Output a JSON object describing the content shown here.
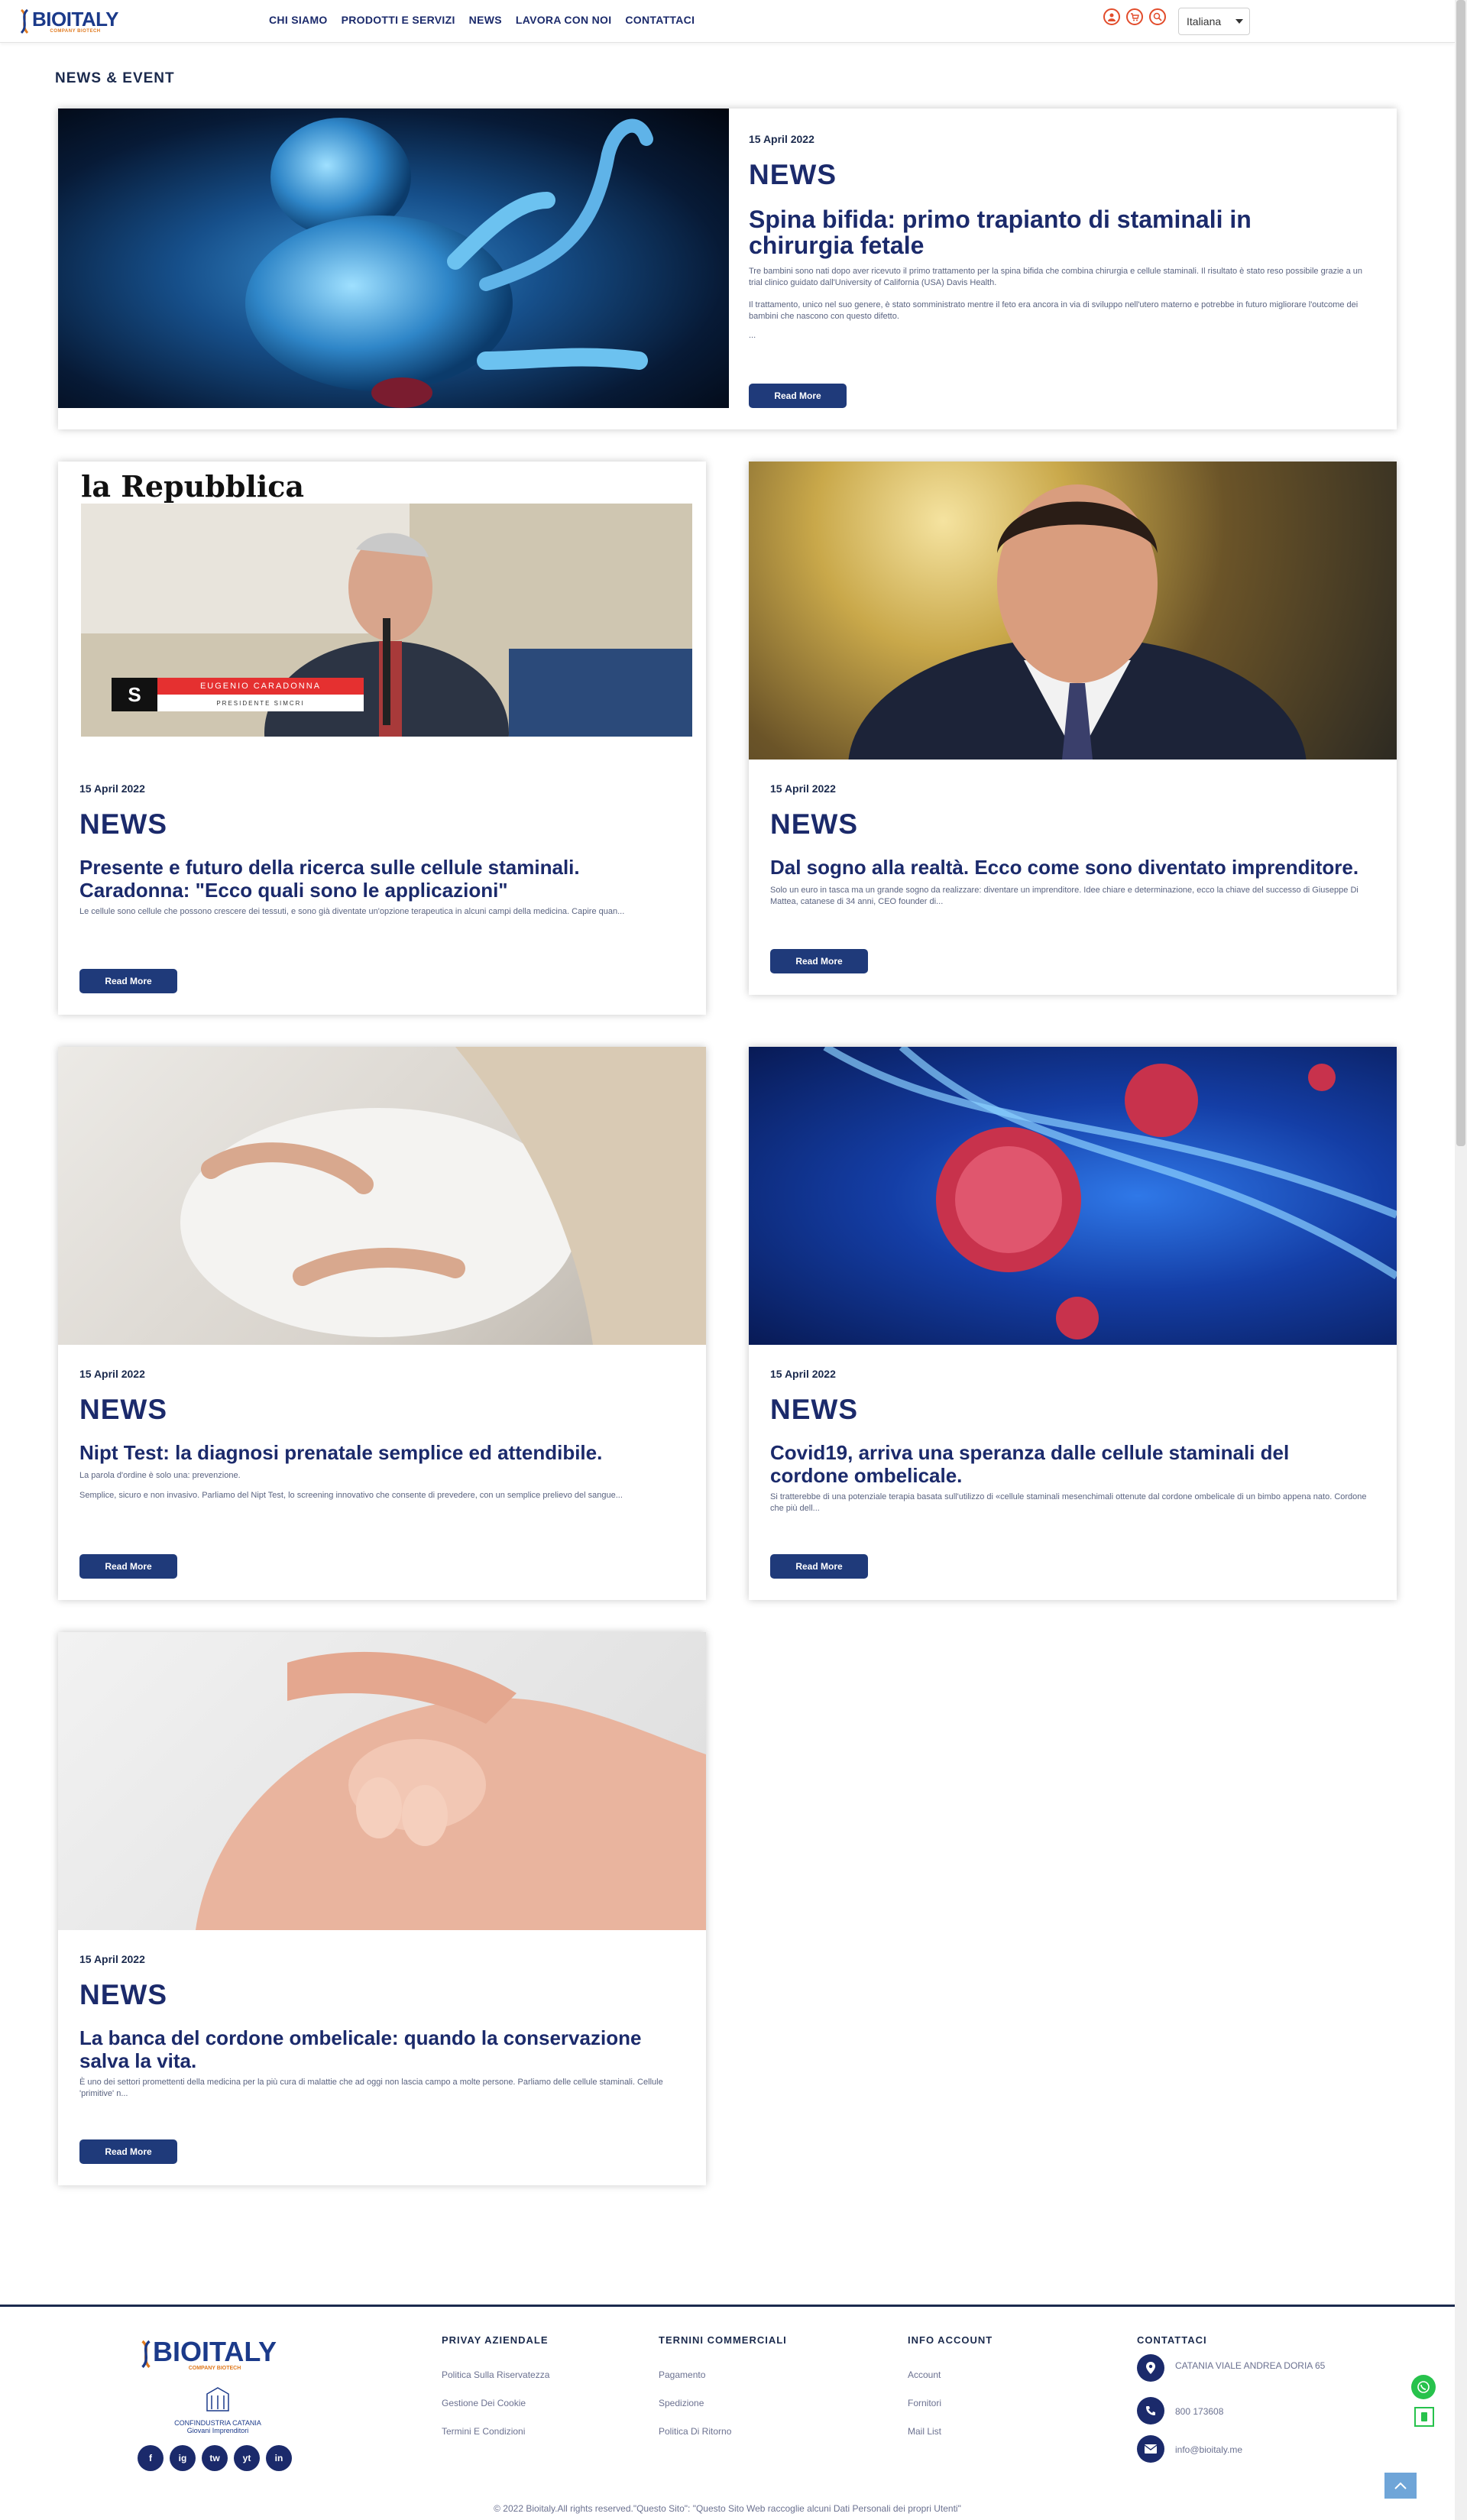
{
  "header": {
    "brand": "BIOITALY",
    "brand_sub": "COMPANY BIOTECH",
    "nav": [
      "CHI SIAMO",
      "PRODOTTI E SERVIZI",
      "NEWS",
      "LAVORA CON NOI",
      "CONTATTACI"
    ],
    "language": "Italiana",
    "icons": [
      "user-icon",
      "cart-icon",
      "search-icon"
    ]
  },
  "section_title": "NEWS & EVENT",
  "read_more": "Read More",
  "articles": [
    {
      "date": "15 April 2022",
      "label": "NEWS",
      "title": "Spina bifida: primo trapianto di staminali in chirurgia fetale",
      "excerpt": "Tre bambini sono nati dopo aver ricevuto il primo trattamento per la spina bifida che combina chirurgia e cellule staminali. Il risultato è stato reso possibile grazie a un trial clinico guidato dall'University of California (USA) Davis Health.",
      "excerpt2": "Il trattamento, unico nel suo genere, è stato somministrato mentre il feto era ancora in via di sviluppo nell'utero materno e potrebbe in futuro migliorare l'outcome dei bambini che nascono con questo difetto.",
      "excerpt3": "...",
      "image": "fetus-illustration"
    },
    {
      "date": "15 April 2022",
      "label": "NEWS",
      "title": "Presente e futuro della ricerca sulle cellule staminali. Caradonna: \"Ecco quali sono le applicazioni\"",
      "excerpt": "Le cellule sono cellule che possono crescere dei tessuti, e sono già diventate un'opzione terapeutica in alcuni campi della medicina. Capire quan...",
      "image": "repubblica-interview",
      "image_header": "la Repubblica",
      "image_caption_name": "EUGENIO CARADONNA",
      "image_caption_role": "PRESIDENTE SIMCRI"
    },
    {
      "date": "15 April 2022",
      "label": "NEWS",
      "title": "Dal sogno alla realtà. Ecco come sono diventato imprenditore.",
      "excerpt": "Solo un euro in tasca ma un grande sogno da realizzare: diventare un imprenditore. Idee chiare e determinazione, ecco la chiave del successo di Giuseppe Di Mattea, catanese di 34 anni, CEO founder di...",
      "image": "portrait-businessman"
    },
    {
      "date": "15 April 2022",
      "label": "NEWS",
      "title": "Nipt Test: la diagnosi prenatale semplice ed attendibile.",
      "excerpt": "La parola d'ordine è solo una: prevenzione.",
      "excerpt2": "Semplice, sicuro e non invasivo. Parliamo del Nipt Test, lo screening innovativo che consente di prevedere, con un semplice prelievo del sangue...",
      "image": "pregnant-woman"
    },
    {
      "date": "15 April 2022",
      "label": "NEWS",
      "title": "Covid19, arriva una speranza dalle cellule staminali del cordone ombelicale.",
      "excerpt": "Si tratterebbe di una potenziale terapia basata sull'utilizzo di «cellule staminali mesenchimali ottenute dal cordone ombelicale di un bimbo appena nato. Cordone che più dell...",
      "image": "virus-dna"
    },
    {
      "date": "15 April 2022",
      "label": "NEWS",
      "title": "La banca del cordone ombelicale: quando la conservazione salva la vita.",
      "excerpt": "È uno dei settori promettenti della medicina per la più cura di malattie che ad oggi non lascia campo a molte persone. Parliamo delle cellule staminali. Cellule 'primitive' n...",
      "image": "baby-hand"
    }
  ],
  "footer": {
    "brand": "BIOITALY",
    "brand_sub": "COMPANY BIOTECH",
    "partner": "CONFINDUSTRIA CATANIA",
    "partner_sub": "Giovani Imprenditori",
    "privacy_title": "PRIVAY AZIENDALE",
    "privacy_links": [
      "Politica Sulla Riservatezza",
      "Gestione Dei Cookie",
      "Termini E Condizioni"
    ],
    "terms_title": "TERNINI COMMERCIALI",
    "terms_links": [
      "Pagamento",
      "Spedizione",
      "Politica Di Ritorno"
    ],
    "account_title": "INFO ACCOUNT",
    "account_links": [
      "Account",
      "Fornitori",
      "Mail List"
    ],
    "contact_title": "CONTATTACI",
    "address": "CATANIA VIALE ANDREA DORIA 65",
    "phone": "800 173608",
    "email": "info@bioitaly.me",
    "social": [
      "f",
      "ig",
      "tw",
      "yt",
      "in"
    ],
    "copyright": "© 2022 Bioitaly.All rights reserved.\"Questo Sito\": \"Questo Sito Web raccoglie alcuni Dati Personali dei propri Utenti\""
  }
}
